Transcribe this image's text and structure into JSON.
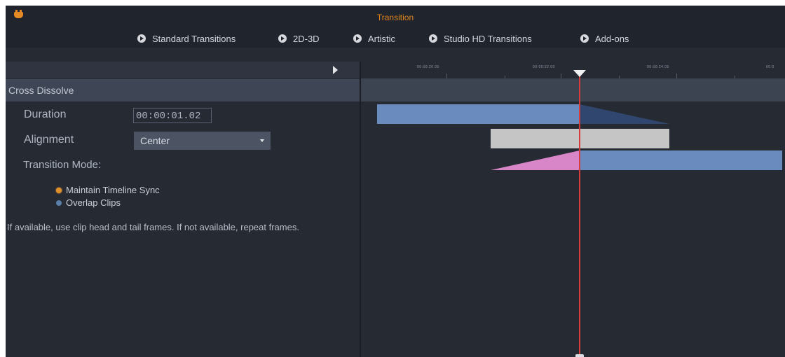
{
  "window": {
    "title": "Transition"
  },
  "tabs": [
    {
      "label": "Standard Transitions"
    },
    {
      "label": "2D-3D"
    },
    {
      "label": "Artistic"
    },
    {
      "label": "Studio HD Transitions"
    },
    {
      "label": "Add-ons"
    }
  ],
  "panel": {
    "title": "Cross Dissolve",
    "duration_label": "Duration",
    "duration_value": "00:00:01.02",
    "alignment_label": "Alignment",
    "alignment_value": "Center",
    "mode_label": "Transition Mode:",
    "mode_options": [
      {
        "label": "Maintain Timeline Sync",
        "selected": true
      },
      {
        "label": "Overlap Clips",
        "selected": false
      }
    ],
    "hint": "If available, use clip head and tail frames. If not available, repeat frames."
  },
  "timeline": {
    "ruler_labels": [
      "00:00:20.00",
      "00:00:22.00",
      "00:00:24.00",
      "00:0"
    ]
  },
  "colors": {
    "accent": "#e0841c",
    "clip_blue": "#6a8bbd",
    "clip_grey": "#c5c5c5",
    "fade_pink": "#d886c8",
    "playhead": "#d83b3b"
  }
}
